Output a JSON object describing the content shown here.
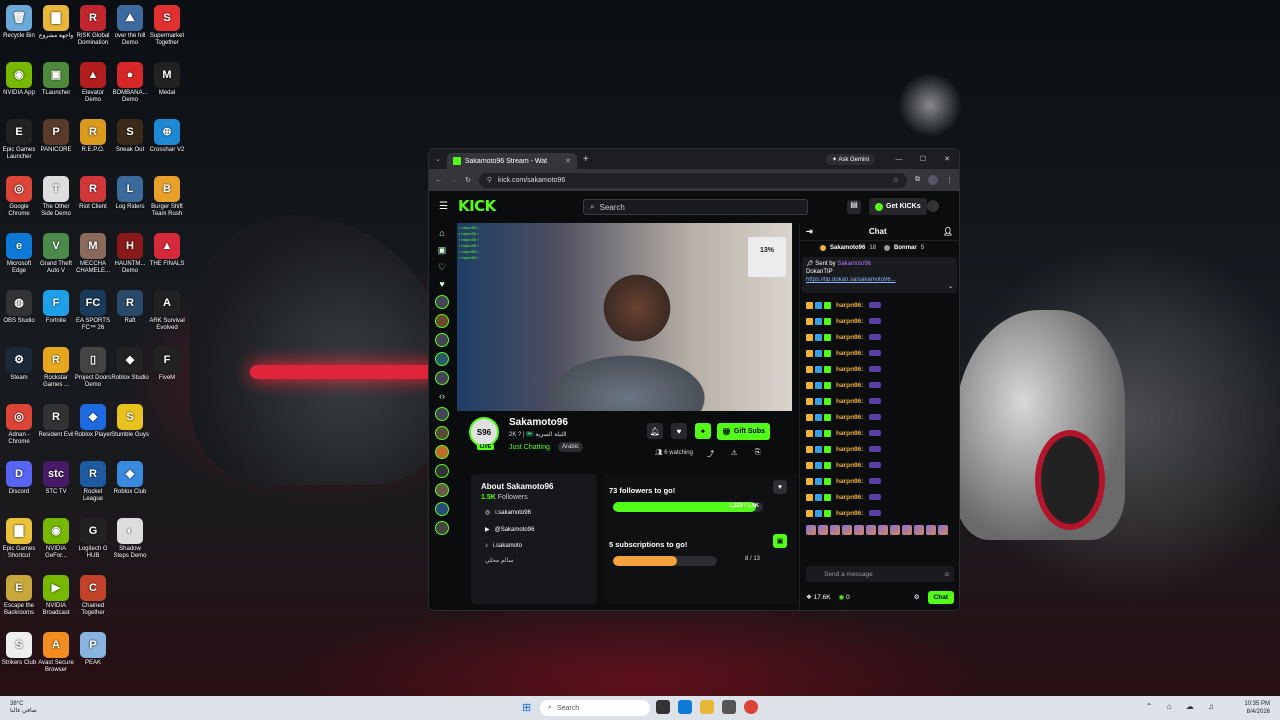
{
  "desktop": {
    "icons": [
      {
        "label": "Recycle Bin",
        "color": "#6aa9d8",
        "glyph": "🗑"
      },
      {
        "label": "واجهة مشروع",
        "color": "#e8b73a",
        "glyph": "▇"
      },
      {
        "label": "RISK Global Domination",
        "color": "#c0272d",
        "glyph": "R"
      },
      {
        "label": "over the hill Demo",
        "color": "#3d6ba0",
        "glyph": "⛰"
      },
      {
        "label": "Supermarket Together",
        "color": "#e03131",
        "glyph": "S"
      },
      {
        "label": "NVIDIA App",
        "color": "#76b900",
        "glyph": "◉"
      },
      {
        "label": "TLauncher",
        "color": "#4f8a3a",
        "glyph": "▣"
      },
      {
        "label": "Elevator Demo",
        "color": "#b21e1e",
        "glyph": "▲"
      },
      {
        "label": "BOMBANA... Demo",
        "color": "#d62828",
        "glyph": "●"
      },
      {
        "label": "Medal",
        "color": "#222",
        "glyph": "M"
      },
      {
        "label": "Epic Games Launcher",
        "color": "#222",
        "glyph": "E"
      },
      {
        "label": "PANICORE",
        "color": "#5a3a2a",
        "glyph": "P"
      },
      {
        "label": "R.E.P.O.",
        "color": "#d99a1e",
        "glyph": "R"
      },
      {
        "label": "Sneak Out",
        "color": "#3a2a1a",
        "glyph": "S"
      },
      {
        "label": "Crosshair V2",
        "color": "#1e8ad6",
        "glyph": "⊕"
      },
      {
        "label": "Google Chrome",
        "color": "#db4437",
        "glyph": "◎"
      },
      {
        "label": "The Other Side Demo",
        "color": "#ddd",
        "glyph": "T"
      },
      {
        "label": "Riot Client",
        "color": "#d13639",
        "glyph": "R"
      },
      {
        "label": "Log Riders",
        "color": "#3a6b9a",
        "glyph": "L"
      },
      {
        "label": "Burger Shift Team Rush",
        "color": "#e8a02a",
        "glyph": "B"
      },
      {
        "label": "Microsoft Edge",
        "color": "#0c7ad6",
        "glyph": "e"
      },
      {
        "label": "Grand Theft Auto V",
        "color": "#4a8a4a",
        "glyph": "V"
      },
      {
        "label": "MECCHA CHAMELE...",
        "color": "#8a6a5a",
        "glyph": "M"
      },
      {
        "label": "HAUNTM... Demo",
        "color": "#8a1a1a",
        "glyph": "H"
      },
      {
        "label": "THE FINALS",
        "color": "#d62a3a",
        "glyph": "▲"
      },
      {
        "label": "OBS Studio",
        "color": "#333",
        "glyph": "◍"
      },
      {
        "label": "Fortnite",
        "color": "#1ea0e8",
        "glyph": "F"
      },
      {
        "label": "EA SPORTS FC™ 26",
        "color": "#1a3a5a",
        "glyph": "FC"
      },
      {
        "label": "Raft",
        "color": "#2a4a6a",
        "glyph": "R"
      },
      {
        "label": "ARK Survival Evolved",
        "color": "#222",
        "glyph": "A"
      },
      {
        "label": "Steam",
        "color": "#1b2838",
        "glyph": "⚙"
      },
      {
        "label": "Rockstar Games ...",
        "color": "#e8a81e",
        "glyph": "R"
      },
      {
        "label": "Project Doors Demo",
        "color": "#444",
        "glyph": "▯"
      },
      {
        "label": "Roblox Studio",
        "color": "#222",
        "glyph": "◆"
      },
      {
        "label": "FiveM",
        "color": "#222",
        "glyph": "F"
      },
      {
        "label": "Adnan - Chrome",
        "color": "#db4437",
        "glyph": "◎"
      },
      {
        "label": "Resident Evil",
        "color": "#333",
        "glyph": "R"
      },
      {
        "label": "Roblox Player",
        "color": "#1e6ae0",
        "glyph": "◆"
      },
      {
        "label": "Stumble Guys",
        "color": "#e8c21e",
        "glyph": "S"
      },
      {
        "label": "",
        "color": "transparent",
        "glyph": ""
      },
      {
        "label": "Discord",
        "color": "#5865f2",
        "glyph": "D"
      },
      {
        "label": "STC TV",
        "color": "#4a1a6a",
        "glyph": "stc"
      },
      {
        "label": "Rocket League",
        "color": "#1e5aa0",
        "glyph": "R"
      },
      {
        "label": "Roblox Club",
        "color": "#3a8ae0",
        "glyph": "◆"
      },
      {
        "label": "",
        "color": "transparent",
        "glyph": ""
      },
      {
        "label": "Epic Games Shortcut",
        "color": "#e8c23a",
        "glyph": "▇"
      },
      {
        "label": "NVIDIA GeFor...",
        "color": "#76b900",
        "glyph": "◉"
      },
      {
        "label": "Logitech G HUB",
        "color": "#222",
        "glyph": "G"
      },
      {
        "label": "Shadow Steps Demo",
        "color": "#ddd",
        "glyph": "◐"
      },
      {
        "label": "",
        "color": "transparent",
        "glyph": ""
      },
      {
        "label": "Escape the Backrooms",
        "color": "#c8a83a",
        "glyph": "E"
      },
      {
        "label": "NVIDIA Broadcast",
        "color": "#76b900",
        "glyph": "▶"
      },
      {
        "label": "Chained Together",
        "color": "#c2422a",
        "glyph": "C"
      },
      {
        "label": "",
        "color": "transparent",
        "glyph": ""
      },
      {
        "label": "",
        "color": "transparent",
        "glyph": ""
      },
      {
        "label": "Strikers Club",
        "color": "#eee",
        "glyph": "S"
      },
      {
        "label": "Avast Secure Browser",
        "color": "#f28c1e",
        "glyph": "A"
      },
      {
        "label": "PEAK",
        "color": "#8ab4e0",
        "glyph": "P"
      }
    ]
  },
  "browser": {
    "tab_title": "Sakamoto96 Stream - Wat",
    "new_tab": "+",
    "ask_gemini": "Ask Gemini",
    "url": "kick.com/sakamoto96",
    "win_min": "—",
    "win_max": "☐",
    "win_close": "✕"
  },
  "kick": {
    "logo": "KICK",
    "search_placeholder": "Search",
    "get_kicks": "Get KICKs",
    "video_card_text": "13%",
    "channel": {
      "name": "Sakamoto96",
      "avatar_text": "S96",
      "live": "LIVE",
      "subtitle": "2K ? | 🇸🇦 الليلة السرية",
      "category": "Just Chatting",
      "tag": "Arabic",
      "watching": "6 watching",
      "gift_subs": "Gift Subs"
    },
    "about": {
      "title": "About Sakamoto96",
      "followers_count": "1.5K",
      "followers_label": "Followers",
      "socials": [
        "i.sakamoto96",
        "@Sakamoto96",
        "i.sakamoto"
      ],
      "footer": "سالم محلي"
    },
    "goals": [
      {
        "title": "73 followers to go!",
        "bar_label": "1,529 / 1.6K",
        "progress": 0.955,
        "color": "#53fc18",
        "icon_color": "#2b2d31"
      },
      {
        "title": "5 subscriptions to go!",
        "bar_label": "",
        "count": "8 / 13",
        "progress": 0.615,
        "color": "#f2a33a",
        "icon_color": "#53fc18"
      }
    ],
    "chat": {
      "title": "Chat",
      "leader1": "Sakamoto96",
      "leader1_count": "18",
      "leader2": "Bonmar",
      "leader2_count": "5",
      "pinned_by": "Sent by",
      "pinned_user": "Sakamoto96",
      "pinned_title": "DokanTIP",
      "pinned_link": "https://tip.dokan.sa/sakamoto96...",
      "messages": [
        "harpn96:",
        "harpn96:",
        "harpn96:",
        "harpn96:",
        "harpn96:",
        "harpn96:",
        "harpn96:",
        "harpn96:",
        "harpn96:",
        "harpn96:",
        "harpn96:",
        "harpn96:",
        "harpn96:",
        "harpn96:"
      ],
      "send_placeholder": "Send a message",
      "kicks_count": "17.6K",
      "points": "0",
      "chat_button": "Chat"
    }
  },
  "taskbar": {
    "weather_temp": "38°C",
    "weather_desc": "صافي غالبا",
    "search": "Search",
    "time": "10:35 PM",
    "date": "8/4/2026"
  }
}
